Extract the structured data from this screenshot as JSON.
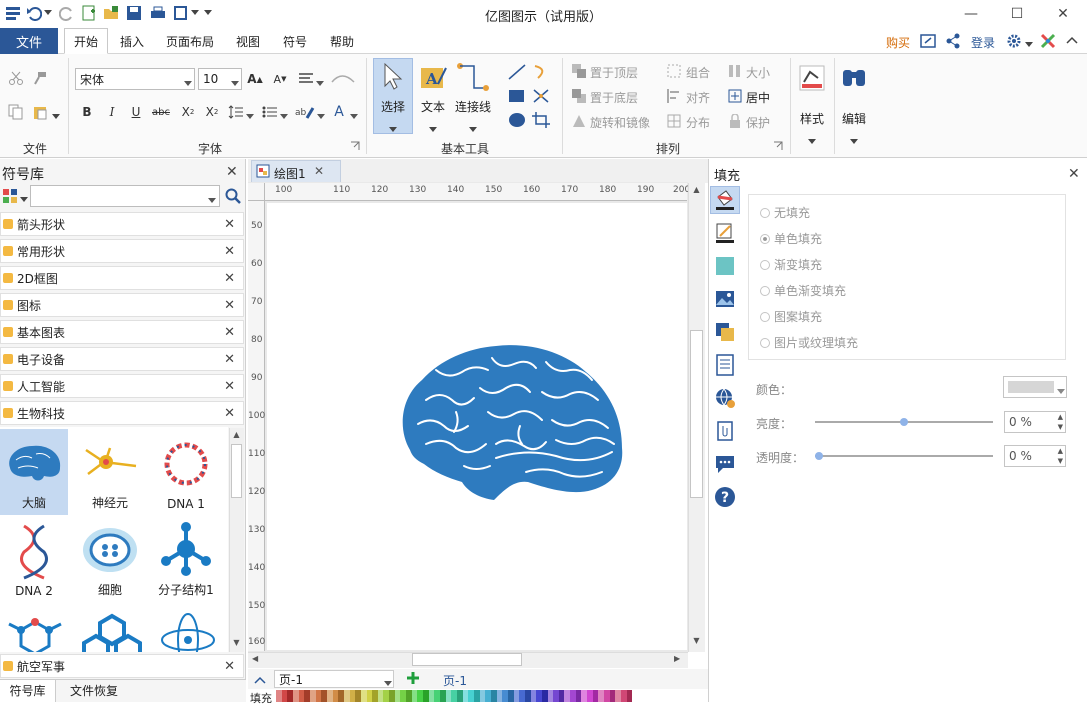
{
  "app": {
    "title": "亿图图示（试用版）"
  },
  "menu": {
    "file": "文件",
    "tabs": [
      "开始",
      "插入",
      "页面布局",
      "视图",
      "符号",
      "帮助"
    ]
  },
  "account": {
    "buy": "购买",
    "login": "登录"
  },
  "ribbon": {
    "groups": {
      "file": "文件",
      "font": "字体",
      "basic_tools": "基本工具",
      "arrange": "排列"
    },
    "font_name": "宋体",
    "font_size": "10",
    "select": "选择",
    "text": "文本",
    "connector": "连接线",
    "bring_front": "置于顶层",
    "send_back": "置于底层",
    "rotate_mirror": "旋转和镜像",
    "group": "组合",
    "align": "对齐",
    "distribute": "分布",
    "size": "大小",
    "center": "居中",
    "protect": "保护",
    "style": "样式",
    "edit": "编辑"
  },
  "library": {
    "title": "符号库",
    "categories": [
      "箭头形状",
      "常用形状",
      "2D框图",
      "图标",
      "基本图表",
      "电子设备",
      "人工智能",
      "生物科技"
    ],
    "symbols": [
      "大脑",
      "神经元",
      "DNA 1",
      "DNA 2",
      "细胞",
      "分子结构1"
    ],
    "bottom_category": "航空军事",
    "tabs": [
      "符号库",
      "文件恢复"
    ]
  },
  "document": {
    "tab": "绘图1",
    "page_selector": "页-1",
    "page_tab": "页-1",
    "fill_label": "填充"
  },
  "ruler": {
    "h": [
      "100",
      "110",
      "120",
      "130",
      "140",
      "150",
      "160",
      "170",
      "180",
      "190",
      "200"
    ],
    "v": [
      "50",
      "60",
      "70",
      "80",
      "90",
      "100",
      "110",
      "120",
      "130",
      "140",
      "150",
      "160"
    ]
  },
  "fill_panel": {
    "title": "填充",
    "options": [
      "无填充",
      "单色填充",
      "渐变填充",
      "单色渐变填充",
      "图案填充",
      "图片或纹理填充"
    ],
    "selected": "单色填充",
    "color_label": "颜色：",
    "brightness_label": "亮度：",
    "transparency_label": "透明度：",
    "brightness_value": "0 %",
    "transparency_value": "0 %",
    "brightness_level": 0.5,
    "transparency_level": 0.0
  },
  "colors": {
    "accent": "#2b5797",
    "brain": "#2e7bbf",
    "selected_symbol_bg": "#c5d9f1"
  }
}
